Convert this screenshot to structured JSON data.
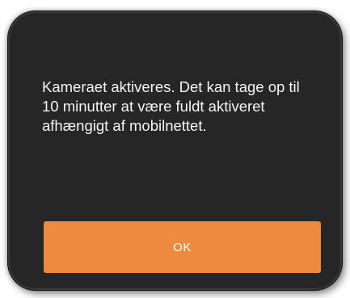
{
  "dialog": {
    "message": "Kameraet aktiveres. Det kan tage op til 10 minutter at være fuldt aktiveret afhængigt af mobilnettet.",
    "ok_label": "OK"
  },
  "colors": {
    "dialog_background": "#262626",
    "button_background": "#ee8a3e",
    "text": "#f4f4f4"
  }
}
